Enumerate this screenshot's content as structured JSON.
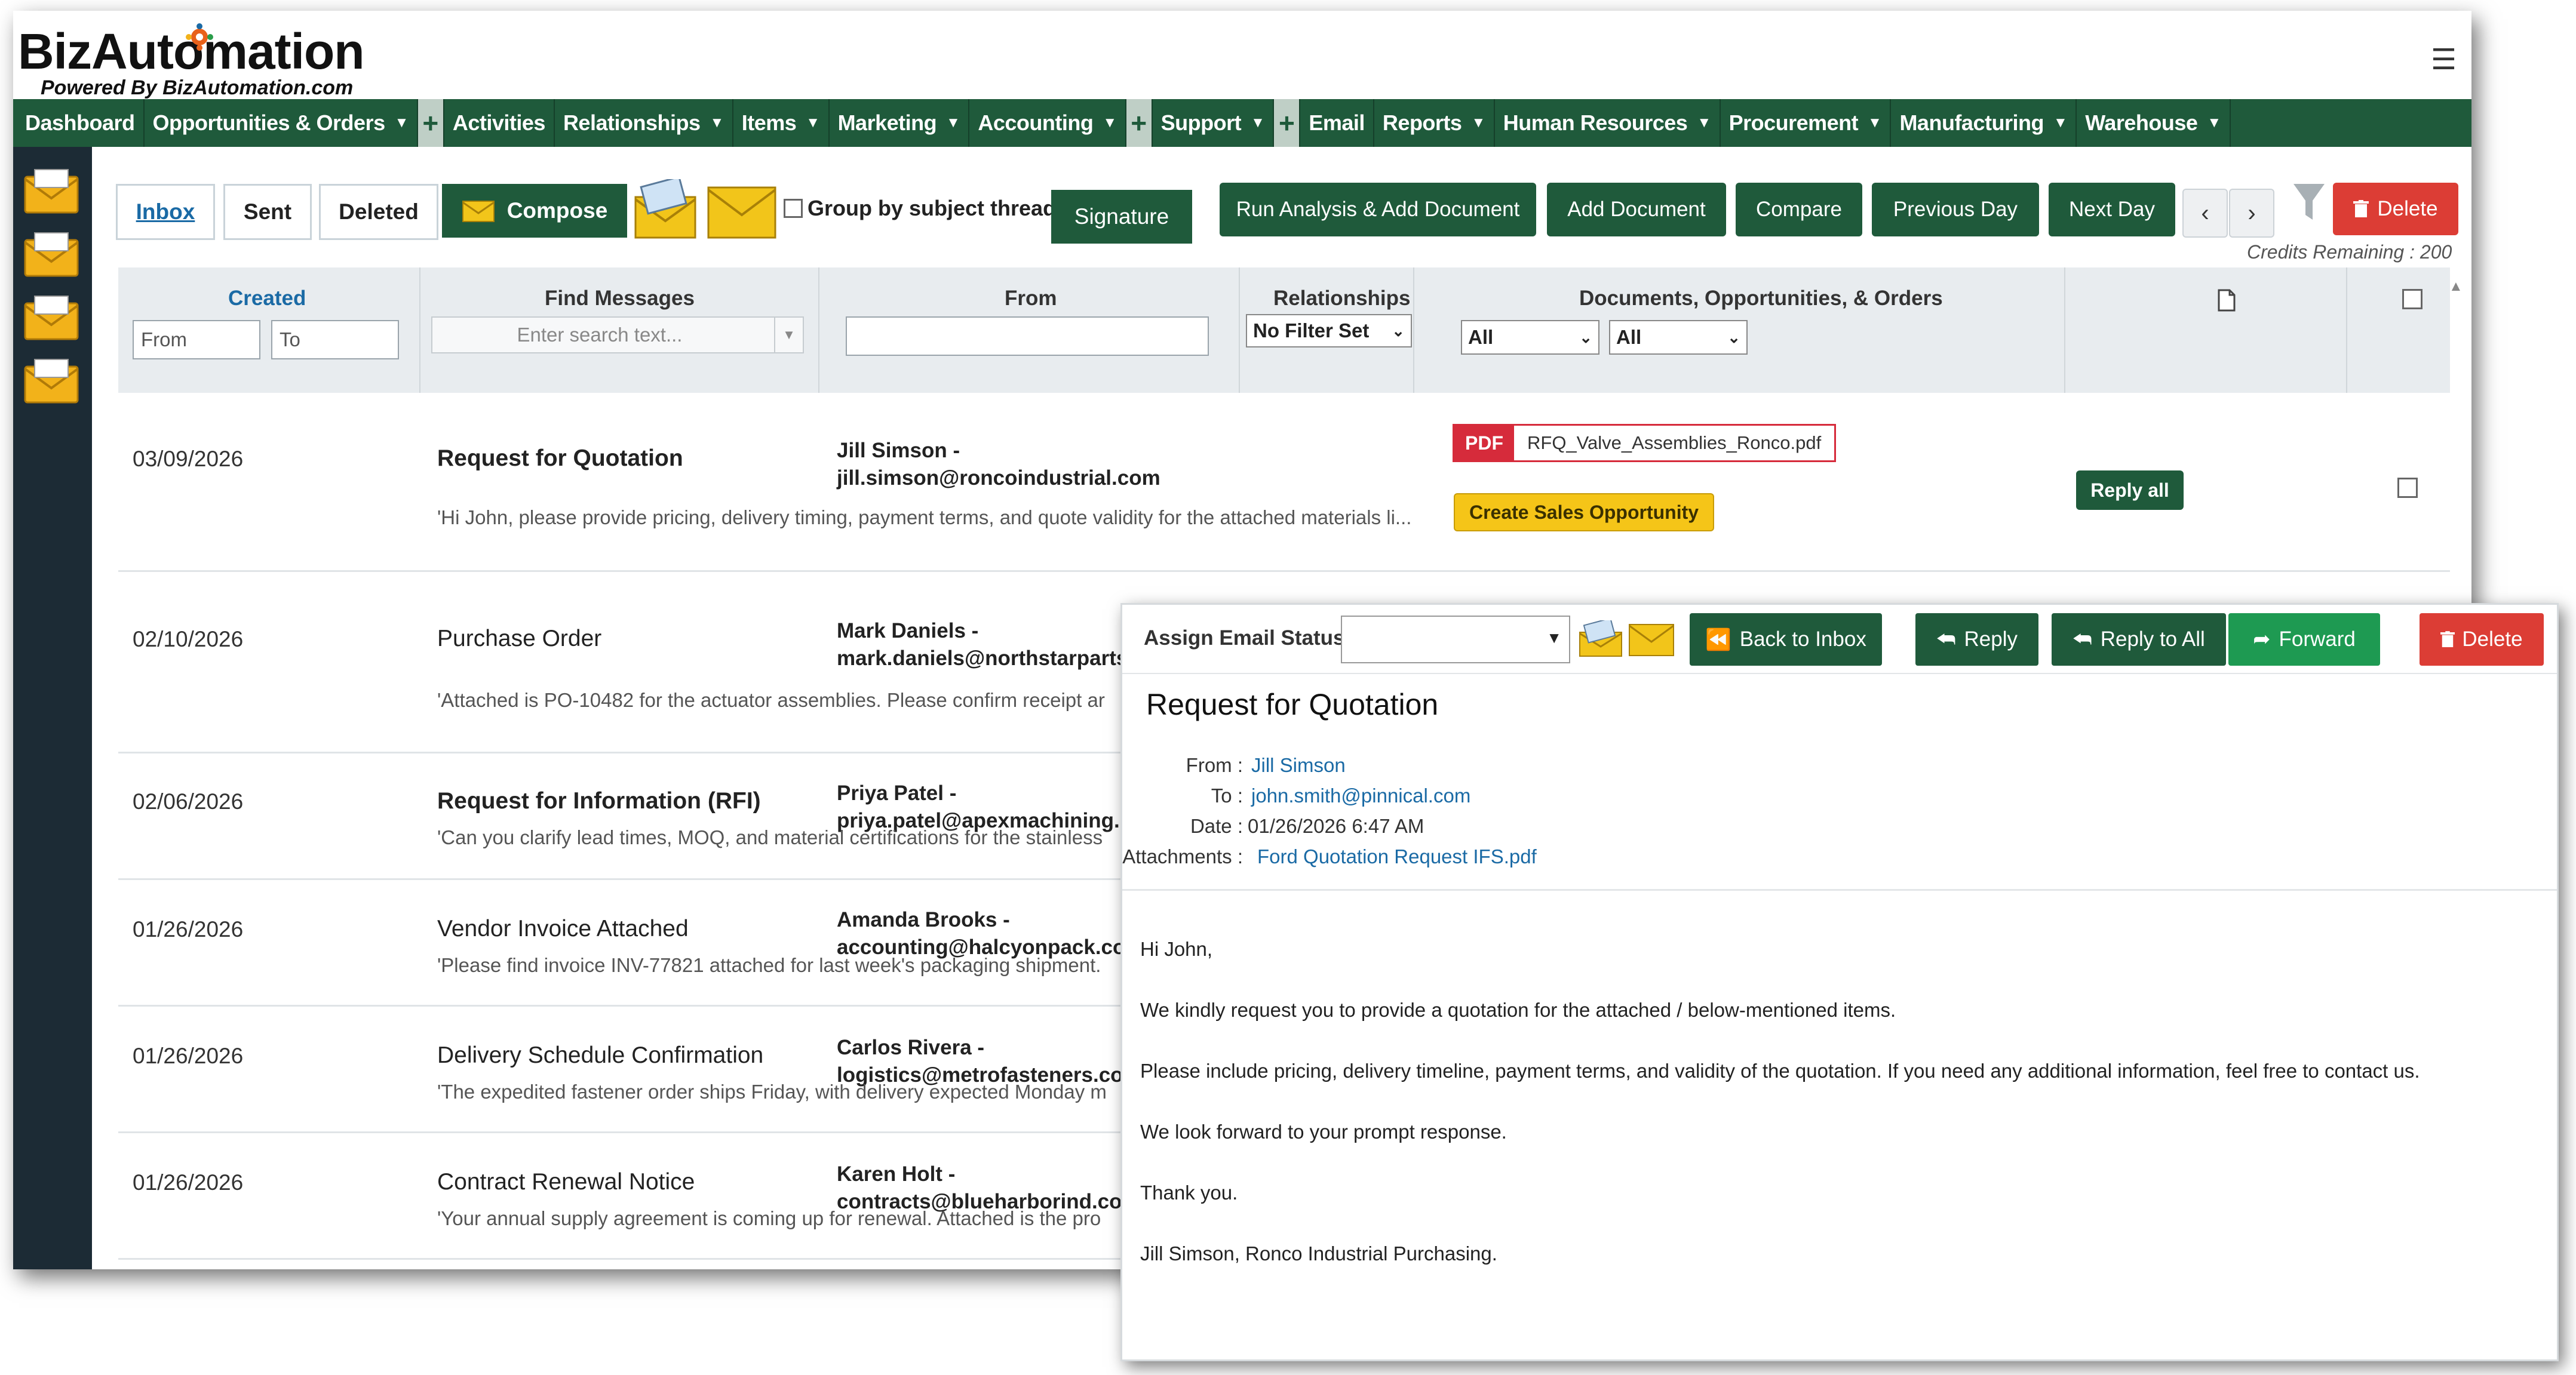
{
  "app": {
    "logo_text": "BizAutomation",
    "logo_sub": "Powered By BizAutomation.com"
  },
  "nav": {
    "items": [
      {
        "label": "Dashboard",
        "dropdown": false
      },
      {
        "label": "Opportunities & Orders",
        "dropdown": true
      },
      {
        "label": "+",
        "plus": true
      },
      {
        "label": "Activities",
        "dropdown": false
      },
      {
        "label": "Relationships",
        "dropdown": true
      },
      {
        "label": "Items",
        "dropdown": true
      },
      {
        "label": "Marketing",
        "dropdown": true
      },
      {
        "label": "Accounting",
        "dropdown": true
      },
      {
        "label": "+",
        "plus": true
      },
      {
        "label": "Support",
        "dropdown": true
      },
      {
        "label": "+",
        "plus": true
      },
      {
        "label": "Email",
        "dropdown": false
      },
      {
        "label": "Reports",
        "dropdown": true
      },
      {
        "label": "Human Resources",
        "dropdown": true
      },
      {
        "label": "Procurement",
        "dropdown": true
      },
      {
        "label": "Manufacturing",
        "dropdown": true
      },
      {
        "label": "Warehouse",
        "dropdown": true
      }
    ]
  },
  "toolbar": {
    "inbox": "Inbox",
    "sent": "Sent",
    "deleted": "Deleted",
    "compose": "Compose",
    "group_by": "Group by subject thread",
    "signature": "Signature",
    "run_analysis": "Run Analysis & Add Document",
    "add_document": "Add Document",
    "compare": "Compare",
    "previous_day": "Previous Day",
    "next_day": "Next Day",
    "prev_arrow": "‹",
    "next_arrow": "›",
    "delete": "Delete",
    "credits": "Credits Remaining : 200"
  },
  "filters": {
    "created": "Created",
    "from_placeholder": "From",
    "to_placeholder": "To",
    "find_messages": "Find Messages",
    "search_placeholder": "Enter search text...",
    "from_col": "From",
    "relationships": "Relationships",
    "relationships_value": "No Filter Set",
    "docs_col": "Documents, Opportunities, & Orders",
    "docs_filter_1": "All",
    "docs_filter_2": "All"
  },
  "messages": [
    {
      "date": "03/09/2026",
      "subject": "Request for Quotation",
      "bold": true,
      "from_name": "Jill Simson -",
      "from_email": "jill.simson@roncoindustrial.com",
      "snippet": "'Hi John, please provide pricing, delivery timing, payment terms, and quote validity for the attached materials li...",
      "attachment": "RFQ_Valve_Assemblies_Ronco.pdf",
      "attachment_type": "PDF",
      "action": "Create Sales Opportunity",
      "reply": "Reply all"
    },
    {
      "date": "02/10/2026",
      "subject": "Purchase Order",
      "bold": false,
      "from_name": "Mark Daniels -",
      "from_email": "mark.daniels@northstarparts.c",
      "snippet": "'Attached is PO-10482 for the actuator assemblies. Please confirm receipt ar"
    },
    {
      "date": "02/06/2026",
      "subject": "Request for Information (RFI)",
      "bold": true,
      "from_name": "Priya Patel -",
      "from_email": "priya.patel@apexmachining.co",
      "snippet": "'Can you clarify lead times, MOQ, and material certifications for the stainless"
    },
    {
      "date": "01/26/2026",
      "subject": "Vendor Invoice Attached",
      "bold": false,
      "from_name": "Amanda Brooks -",
      "from_email": "accounting@halcyonpack.com",
      "snippet": "'Please find invoice INV-77821 attached for last week's packaging shipment."
    },
    {
      "date": "01/26/2026",
      "subject": "Delivery Schedule Confirmation",
      "bold": false,
      "from_name": "Carlos Rivera -",
      "from_email": "logistics@metrofasteners.com",
      "snippet": "'The expedited fastener order ships Friday, with delivery expected Monday m"
    },
    {
      "date": "01/26/2026",
      "subject": "Contract Renewal Notice",
      "bold": false,
      "from_name": "Karen Holt -",
      "from_email": "contracts@blueharborind.com",
      "snippet": "'Your annual supply agreement is coming up for renewal. Attached is the pro"
    }
  ],
  "detail": {
    "assign_label": "Assign Email Status:",
    "back_to_inbox": "Back to Inbox",
    "reply": "Reply",
    "reply_all": "Reply to All",
    "forward": "Forward",
    "delete": "Delete",
    "subject": "Request for Quotation",
    "from_label": "From :",
    "from_value": "Jill Simson",
    "to_label": "To :",
    "to_value": "john.smith@pinnical.com",
    "date_label": "Date :",
    "date_value": "01/26/2026 6:47 AM",
    "attach_label": "Attachments :",
    "attach_value": "Ford Quotation Request IFS.pdf",
    "body": [
      "Hi John,",
      "We kindly request you to provide a quotation for the attached / below-mentioned items.",
      "Please include pricing, delivery timeline, payment terms, and validity of the quotation. If you need any additional information, feel free to contact us.",
      "We look forward to your prompt response.",
      "Thank you.",
      "Jill Simson, Ronco Industrial Purchasing."
    ]
  },
  "colors": {
    "nav_green": "#1f5a3b",
    "sidebar": "#1c2b35",
    "delete_red": "#dc3d35",
    "forward_green": "#1e9a52",
    "link_blue": "#1a6aa5",
    "badge_yellow": "#f5c518"
  }
}
